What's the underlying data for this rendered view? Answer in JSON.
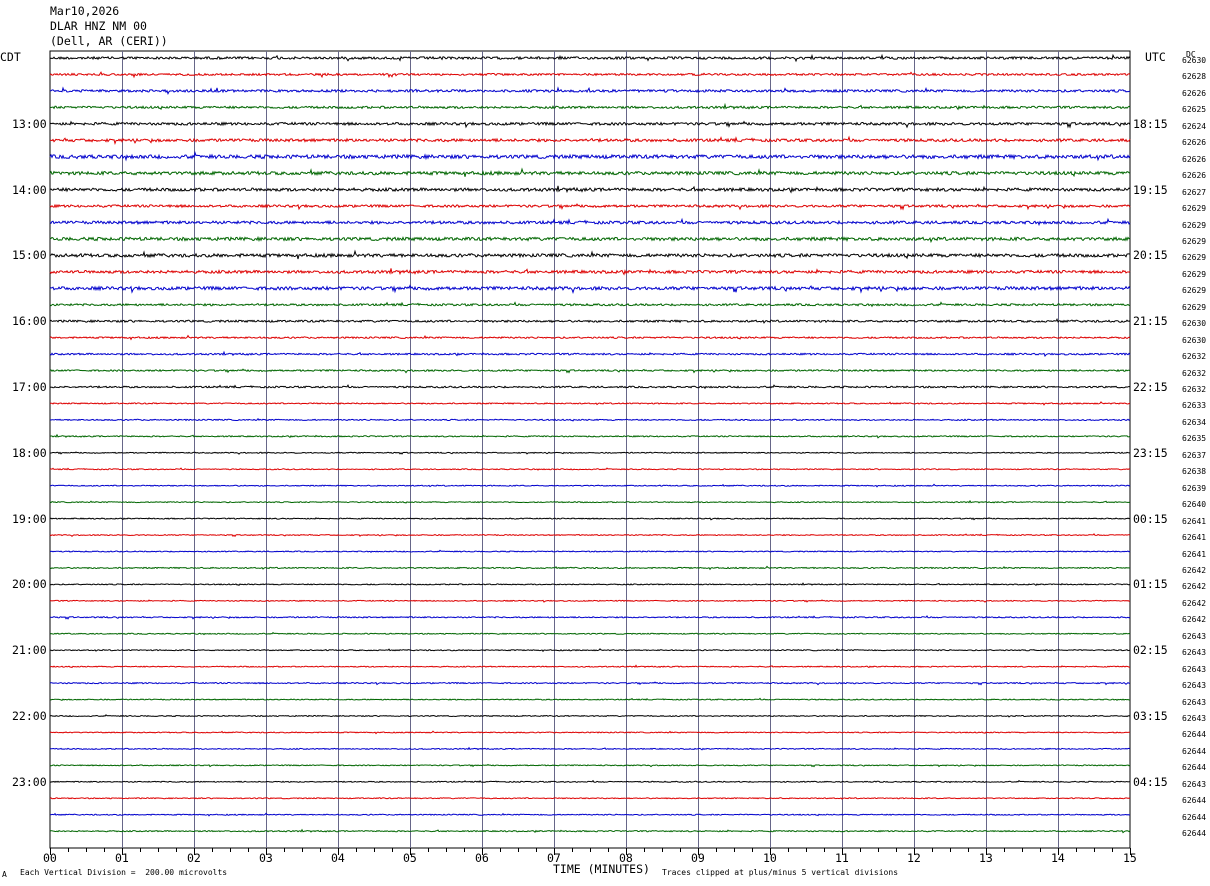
{
  "header": {
    "date": "Mar10,2026",
    "station": "DLAR HNZ NM 00",
    "location": "(Dell, AR (CERI))"
  },
  "left_label": "CDT",
  "right_label": "UTC",
  "dc_label": "DC",
  "footer": {
    "scale_note": "Each Vertical Division =  200.00 microvolts",
    "xlabel": "TIME (MINUTES)",
    "clip_note": "Traces clipped at plus/minus 5 vertical divisions",
    "mark": "A"
  },
  "chart_data": {
    "type": "line",
    "title": "",
    "xlabel": "TIME (MINUTES)",
    "ylabel": "",
    "x_ticks": [
      "00",
      "01",
      "02",
      "03",
      "04",
      "05",
      "06",
      "07",
      "08",
      "09",
      "10",
      "11",
      "12",
      "13",
      "14",
      "15"
    ],
    "xlim": [
      0,
      15
    ],
    "grid": true,
    "trace_colors": [
      "#000000",
      "#dd0000",
      "#0000cc",
      "#006600"
    ],
    "trace_count": 48,
    "traces_per_hour": 4,
    "cdt_hour_labels": [
      "13:00",
      "14:00",
      "15:00",
      "16:00",
      "17:00",
      "18:00",
      "19:00",
      "20:00",
      "21:00",
      "22:00",
      "23:00"
    ],
    "utc_hour_labels": [
      "18:15",
      "19:15",
      "20:15",
      "21:15",
      "22:15",
      "23:15",
      "00:15",
      "01:15",
      "02:15",
      "03:15",
      "04:15"
    ],
    "dc_values": [
      "62630",
      "62628",
      "62626",
      "62625",
      "62624",
      "62626",
      "62626",
      "62626",
      "62627",
      "62629",
      "62629",
      "62629",
      "62629",
      "62629",
      "62629",
      "62629",
      "62630",
      "62630",
      "62632",
      "62632",
      "62632",
      "62633",
      "62634",
      "62635",
      "62637",
      "62638",
      "62639",
      "62640",
      "62641",
      "62641",
      "62641",
      "62642",
      "62642",
      "62642",
      "62642",
      "62643",
      "62643",
      "62643",
      "62643",
      "62643",
      "62643",
      "62644",
      "62644",
      "62644",
      "62643",
      "62644",
      "62644",
      "62644"
    ],
    "trace_noise_amplitude": [
      1.2,
      1.0,
      1.2,
      1.1,
      1.3,
      1.4,
      1.8,
      1.6,
      1.5,
      1.2,
      1.4,
      1.6,
      1.6,
      1.4,
      1.6,
      1.0,
      1.0,
      0.8,
      0.8,
      0.8,
      0.8,
      0.6,
      0.6,
      0.6,
      0.5,
      0.5,
      0.5,
      0.5,
      0.5,
      0.5,
      0.5,
      0.6,
      0.5,
      0.5,
      0.6,
      0.5,
      0.5,
      0.5,
      0.6,
      0.5,
      0.5,
      0.5,
      0.5,
      0.5,
      0.5,
      0.5,
      0.5,
      0.6
    ]
  }
}
